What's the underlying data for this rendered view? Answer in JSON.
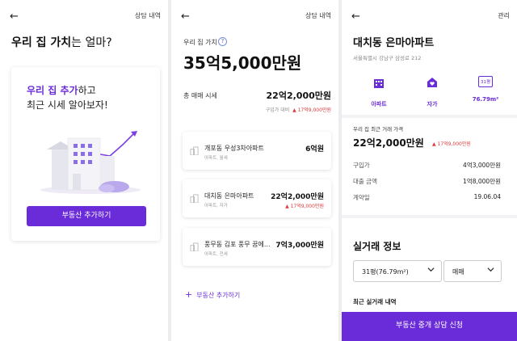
{
  "screen1": {
    "back_icon": "arrow-left-icon",
    "top_link": "상담 내역",
    "title_bold": "우리 집 가치",
    "title_light": "는 얼마?",
    "card_highlight": "우리 집 추가",
    "card_rest": "하고",
    "card_line2": "최근 시세 알아보자!",
    "button": "부동산 추가하기"
  },
  "screen2": {
    "top_link": "상담 내역",
    "value_label": "우리 집 가치",
    "help_icon": "question-circle-icon",
    "total_value": "35억5,000만원",
    "sum_label": "총 매매 시세",
    "sum_value": "22억2,000만원",
    "compare_label": "구입가 대비",
    "compare_change": "▲ 17억9,000만원",
    "properties": [
      {
        "name": "개포동 우성3차아파트",
        "sub": "아파트, 월세",
        "value": "6억원",
        "change": ""
      },
      {
        "name": "대치동 은마아파트",
        "sub": "아파트, 자가",
        "value": "22억2,000만원",
        "change": "▲ 17억9,000만원"
      },
      {
        "name": "풍무동 김포 풍무 꿈에...",
        "sub": "아파트, 전세",
        "value": "7억3,000만원",
        "change": ""
      }
    ],
    "add_label": "부동산 추가하기"
  },
  "screen3": {
    "top_link": "관리",
    "name": "대치동 은마아파트",
    "address": "서울특별시 강남구 삼성로 212",
    "chips": [
      {
        "icon": "building-icon",
        "label": "아파트"
      },
      {
        "icon": "home-heart-icon",
        "label": "자가"
      },
      {
        "icon": "size-badge-icon",
        "badge": "31평",
        "label": "76.79m²"
      }
    ],
    "price_label": "우리 집 최근 거래 가격",
    "price_value": "22억2,000만원",
    "price_change": "▲ 17억9,000만원",
    "rows": [
      {
        "key": "구입가",
        "value": "4억3,000만원"
      },
      {
        "key": "대출 금액",
        "value": "1억8,000만원"
      },
      {
        "key": "계약일",
        "value": "19.06.04"
      }
    ],
    "section_title": "실거래 정보",
    "select_size": "31평(76.79m²)",
    "select_type": "매매",
    "recent_label": "최근 실거래 내역",
    "cta_button": "부동산 중개 상담 신청"
  },
  "colors": {
    "accent": "#6a2bd9",
    "up": "#e03b3b"
  }
}
